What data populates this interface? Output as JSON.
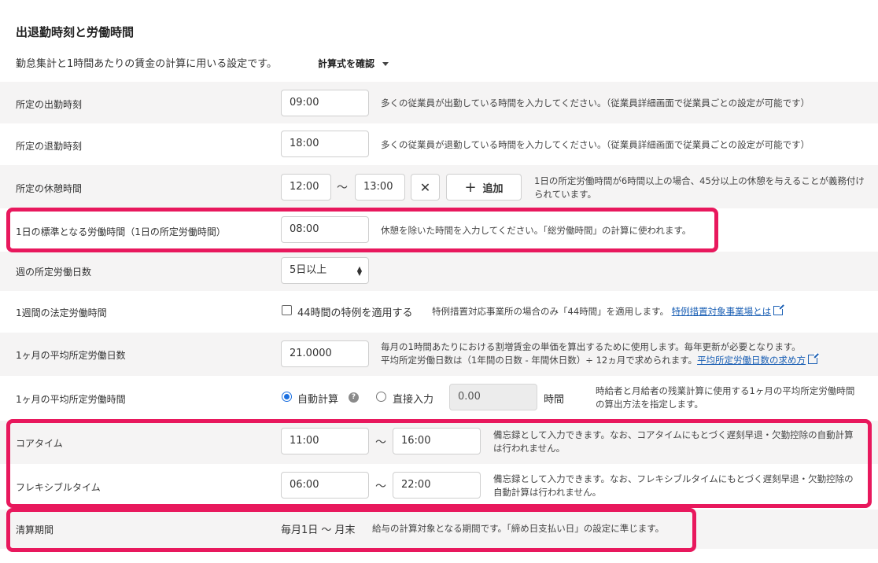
{
  "header": {
    "title": "出退勤時刻と労働時間",
    "description": "勤怠集計と1時間あたりの賃金の計算に用いる設定です。",
    "formula_toggle": "計算式を確認"
  },
  "rows": {
    "start_time": {
      "label": "所定の出勤時刻",
      "value": "09:00",
      "help": "多くの従業員が出勤している時間を入力してください。（従業員詳細画面で従業員ごとの設定が可能です）"
    },
    "end_time": {
      "label": "所定の退勤時刻",
      "value": "18:00",
      "help": "多くの従業員が退勤している時間を入力してください。（従業員詳細画面で従業員ごとの設定が可能です）"
    },
    "break_time": {
      "label": "所定の休憩時間",
      "from": "12:00",
      "separator": "〜",
      "to": "13:00",
      "remove_glyph": "✕",
      "add_label": "追加",
      "add_glyph": "+",
      "help": "1日の所定労働時間が6時間以上の場合、45分以上の休憩を与えることが義務付けられています。"
    },
    "daily_hours": {
      "label": "1日の標準となる労働時間（1日の所定労働時間）",
      "value": "08:00",
      "help": "休憩を除いた時間を入力してください。「総労働時間」の計算に使われます。"
    },
    "weekly_days": {
      "label": "週の所定労働日数",
      "selected": "5日以上"
    },
    "weekly_legal_hours": {
      "label": "1週間の法定労働時間",
      "checkbox_label": "44時間の特例を適用する",
      "checked": false,
      "help": "特例措置対応事業所の場合のみ「44時間」を適用します。",
      "link": "特例措置対象事業場とは"
    },
    "monthly_avg_days": {
      "label": "1ヶ月の平均所定労働日数",
      "value": "21.0000",
      "help_line1": "毎月の1時間あたりにおける割増賃金の単価を算出するために使用します。毎年更新が必要となります。",
      "help_line2": "平均所定労働日数は（1年間の日数 - 年間休日数）÷ 12ヵ月で求められます。",
      "link": "平均所定労働日数の求め方"
    },
    "monthly_avg_hours": {
      "label": "1ヶ月の平均所定労働時間",
      "option_auto": "自動計算",
      "option_manual": "直接入力",
      "selected": "自動計算",
      "help_glyph": "?",
      "value": "0.00",
      "unit": "時間",
      "help": "時給者と月給者の残業計算に使用する1ヶ月の平均所定労働時間の算出方法を指定します。"
    },
    "core_time": {
      "label": "コアタイム",
      "from": "11:00",
      "separator": "〜",
      "to": "16:00",
      "help": "備忘録として入力できます。なお、コアタイムにもとづく遅刻早退・欠勤控除の自動計算は行われません。"
    },
    "flexible_time": {
      "label": "フレキシブルタイム",
      "from": "06:00",
      "separator": "〜",
      "to": "22:00",
      "help": "備忘録として入力できます。なお、フレキシブルタイムにもとづく遅刻早退・欠勤控除の自動計算は行われません。"
    },
    "settlement_period": {
      "label": "清算期間",
      "value": "毎月1日 〜 月末",
      "help": "給与の計算対象となる期間です。「締め日支払い日」の設定に準じます。"
    }
  },
  "colors": {
    "highlight": "#e8185d",
    "row_alt": "#f5f4f4",
    "link": "#1a5fb4",
    "radio_on": "#1a6fe0"
  }
}
